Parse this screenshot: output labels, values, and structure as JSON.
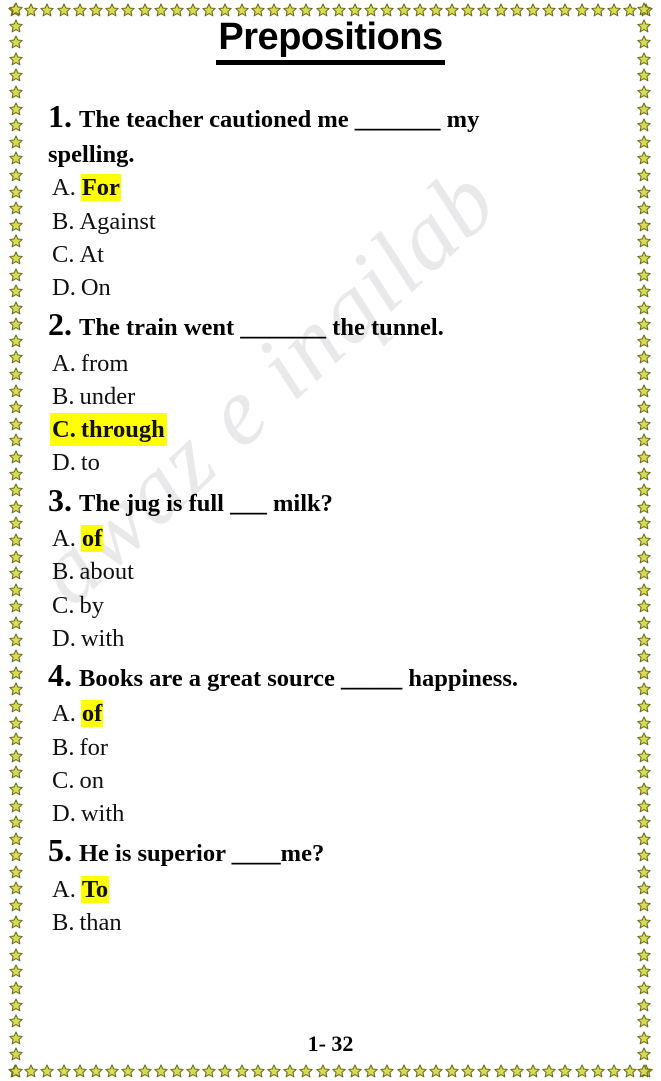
{
  "document": {
    "title": "Prepositions",
    "footer": "1- 32",
    "watermark": "awaz e inqilab",
    "colors": {
      "highlight": "#ffff00",
      "text": "#000000",
      "star_fill": "#d8dc52",
      "star_stroke": "#6b6b1f",
      "watermark": "#e9e9ec"
    }
  },
  "questions": [
    {
      "number": "1.",
      "text_before": "The teacher cautioned me",
      "blank": "_______",
      "text_after": "my spelling.",
      "full_text": "The teacher cautioned me _______ my spelling.",
      "line1": "The teacher cautioned me _______ my",
      "line2": "spelling.",
      "highlight_style": "answer-only",
      "options": [
        {
          "letter": "A.",
          "text": "For",
          "highlighted": true
        },
        {
          "letter": "B.",
          "text": "Against",
          "highlighted": false
        },
        {
          "letter": "C.",
          "text": "At",
          "highlighted": false
        },
        {
          "letter": "D.",
          "text": "On",
          "highlighted": false
        }
      ]
    },
    {
      "number": "2.",
      "text_before": "The train went",
      "blank": "_______",
      "text_after": "the tunnel.",
      "full_text": "The train went _______ the tunnel.",
      "line1": "The train went _______ the tunnel.",
      "line2": "",
      "highlight_style": "whole-line",
      "options": [
        {
          "letter": "A.",
          "text": "from",
          "highlighted": false
        },
        {
          "letter": "B.",
          "text": "under",
          "highlighted": false
        },
        {
          "letter": "C.",
          "text": "through",
          "highlighted": true
        },
        {
          "letter": "D.",
          "text": "to",
          "highlighted": false
        }
      ]
    },
    {
      "number": "3.",
      "text_before": "The jug is full",
      "blank": "___",
      "text_after": "milk?",
      "full_text": "The jug is full ___ milk?",
      "line1": "The jug is full ___ milk?",
      "line2": "",
      "highlight_style": "answer-only",
      "options": [
        {
          "letter": "A.",
          "text": "of",
          "highlighted": true
        },
        {
          "letter": "B.",
          "text": "about",
          "highlighted": false
        },
        {
          "letter": "C.",
          "text": "by",
          "highlighted": false
        },
        {
          "letter": "D.",
          "text": "with",
          "highlighted": false
        }
      ]
    },
    {
      "number": "4.",
      "text_before": "Books are a great source",
      "blank": "_____",
      "text_after": "happiness.",
      "full_text": "Books are a great source _____ happiness.",
      "line1": "Books are a great source _____ happiness.",
      "line2": "",
      "highlight_style": "answer-only",
      "options": [
        {
          "letter": "A.",
          "text": "of",
          "highlighted": true
        },
        {
          "letter": "B.",
          "text": "for",
          "highlighted": false
        },
        {
          "letter": "C.",
          "text": "on",
          "highlighted": false
        },
        {
          "letter": "D.",
          "text": "with",
          "highlighted": false
        }
      ]
    },
    {
      "number": "5.",
      "text_before": "He is superior",
      "blank": "____",
      "text_after": "me?",
      "full_text": "He is superior ____me?",
      "line1": "He is superior ____me?",
      "line2": "",
      "highlight_style": "answer-only",
      "options": [
        {
          "letter": "A.",
          "text": "To",
          "highlighted": true
        },
        {
          "letter": "B.",
          "text": "than",
          "highlighted": false
        }
      ]
    }
  ],
  "border": {
    "icon": "star-icon",
    "top_count": 41,
    "bottom_count": 41,
    "side_count": 65
  }
}
